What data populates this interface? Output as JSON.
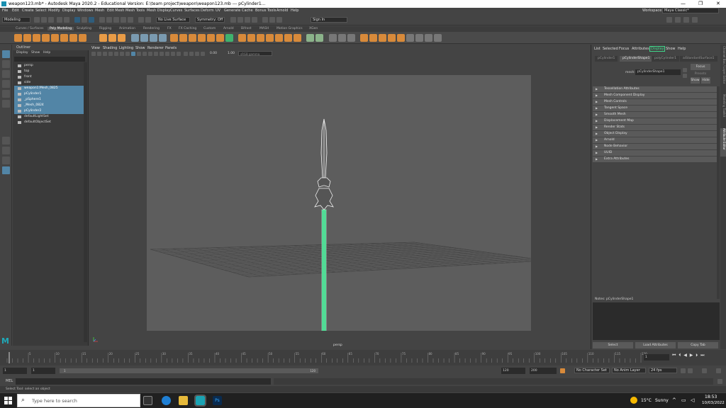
{
  "titlebar": {
    "title": "weapon123.mb* - Autodesk Maya 2020.2 - Educational Version: E:\\team project\\weapon\\weapon123.mb  ---  pCylinder1..."
  },
  "menubar": {
    "items": [
      "File",
      "Edit",
      "Create",
      "Select",
      "Modify",
      "Display",
      "Windows",
      "Mesh",
      "Edit Mesh",
      "Mesh Tools",
      "Mesh Display",
      "Curves",
      "Surfaces",
      "Deform",
      "UV",
      "Generate",
      "Cache",
      "Bonus Tools",
      "Arnold",
      "Help"
    ],
    "workspace_label": "Workspace :",
    "workspace_value": "Maya Classic*"
  },
  "statusline": {
    "mode": "Modeling",
    "live_surface": "No Live Surface",
    "symmetry": "Symmetry: Off",
    "signin": "Sign In"
  },
  "shelf": {
    "tabs": [
      "Curves / Surfaces",
      "Poly Modeling",
      "Sculpting",
      "Rigging",
      "Animation",
      "Rendering",
      "FX",
      "FX Caching",
      "Custom",
      "Arnold",
      "Bifrost",
      "MASH",
      "Motion Graphics",
      "XGen"
    ],
    "active_tab": "Poly Modeling"
  },
  "outliner": {
    "title": "Outliner",
    "menu": [
      "Display",
      "Show",
      "Help"
    ],
    "items": [
      {
        "label": "persp",
        "selected": false
      },
      {
        "label": "top",
        "selected": false
      },
      {
        "label": "front",
        "selected": false
      },
      {
        "label": "side",
        "selected": false
      },
      {
        "label": "weapon1:Mesh_0825",
        "selected": true
      },
      {
        "label": "pCylinder1",
        "selected": true
      },
      {
        "label": "_pSphere1",
        "selected": true
      },
      {
        "label": "_Mesh_0824",
        "selected": true
      },
      {
        "label": "pCylinder2",
        "selected": true
      },
      {
        "label": "defaultLightSet",
        "selected": false
      },
      {
        "label": "defaultObjectSet",
        "selected": false
      }
    ]
  },
  "viewport": {
    "menu": [
      "View",
      "Shading",
      "Lighting",
      "Show",
      "Renderer",
      "Panels"
    ],
    "exposure": "0.00",
    "gamma": "1.00",
    "colorspace": "sRGB gamma",
    "camera_label": "persp"
  },
  "attribute_editor": {
    "menu": [
      "List",
      "Selected",
      "Focus",
      "Attributes",
      "Display",
      "Show",
      "Help"
    ],
    "highlight_menu": "Display",
    "tabs": [
      "pCylinder1",
      "pCylinderShape1",
      "polyCylinder1",
      "aiStandardSurface1"
    ],
    "active_tab": "pCylinderShape1",
    "mesh_label": "mesh:",
    "mesh_value": "pCylinderShape1",
    "focus_btn": "Focus",
    "presets_btn": "Presets",
    "show_btn": "Show",
    "hide_btn": "Hide",
    "sections": [
      "Tessellation Attributes",
      "Mesh Component Display",
      "Mesh Controls",
      "Tangent Space",
      "Smooth Mesh",
      "Displacement Map",
      "Render Stats",
      "Object Display",
      "Arnold",
      "Node Behavior",
      "UUID",
      "Extra Attributes"
    ],
    "notes_label": "Notes:  pCylinderShape1",
    "select_btn": "Select",
    "load_btn": "Load Attributes",
    "copy_btn": "Copy Tab"
  },
  "side_tabs": [
    "Channel Box / Layer Editor",
    "Modeling Toolkit",
    "Attribute Editor"
  ],
  "timeline": {
    "ticks": [
      "5",
      "10",
      "15",
      "20",
      "25",
      "30",
      "35",
      "40",
      "45",
      "50",
      "55",
      "60",
      "65",
      "70",
      "75",
      "80",
      "85",
      "90",
      "95",
      "100",
      "105",
      "110",
      "115",
      "120"
    ],
    "current_frame": "1"
  },
  "range": {
    "start": "1",
    "start2": "1",
    "slider_start": "1",
    "slider_end": "120",
    "end1": "120",
    "end2": "200",
    "character_set": "No Character Set",
    "anim_layer": "No Anim Layer",
    "fps": "24 fps"
  },
  "command": {
    "mel_label": "MEL"
  },
  "helpline": {
    "text": "Select Tool: select an object"
  },
  "taskbar": {
    "search_placeholder": "Type here to search",
    "weather_temp": "15°C",
    "weather_text": "Sunny",
    "time": "18:53",
    "date": "10/03/2022"
  },
  "colors": {
    "selection_blue": "#5285a6",
    "blade_green": "#3fd68a",
    "viewport_bg": "#5d5d5d"
  }
}
